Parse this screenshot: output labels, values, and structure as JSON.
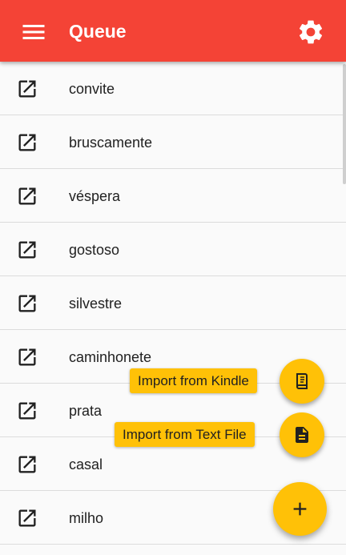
{
  "appbar": {
    "title": "Queue",
    "color": "#f44336",
    "menu_icon": "menu-icon",
    "settings_icon": "gear-icon"
  },
  "queue": {
    "item_icon": "open-in-new-icon",
    "items": [
      {
        "word": "convite"
      },
      {
        "word": "bruscamente"
      },
      {
        "word": "véspera"
      },
      {
        "word": "gostoso"
      },
      {
        "word": "silvestre"
      },
      {
        "word": "caminhonete"
      },
      {
        "word": "prata"
      },
      {
        "word": "casal"
      },
      {
        "word": "milho"
      }
    ]
  },
  "speed_dial": {
    "accent_color": "#ffc107",
    "actions": [
      {
        "label": "Import from Kindle",
        "icon": "kindle-book-icon"
      },
      {
        "label": "Import from Text File",
        "icon": "text-file-icon"
      }
    ],
    "main_icon": "plus-icon"
  }
}
